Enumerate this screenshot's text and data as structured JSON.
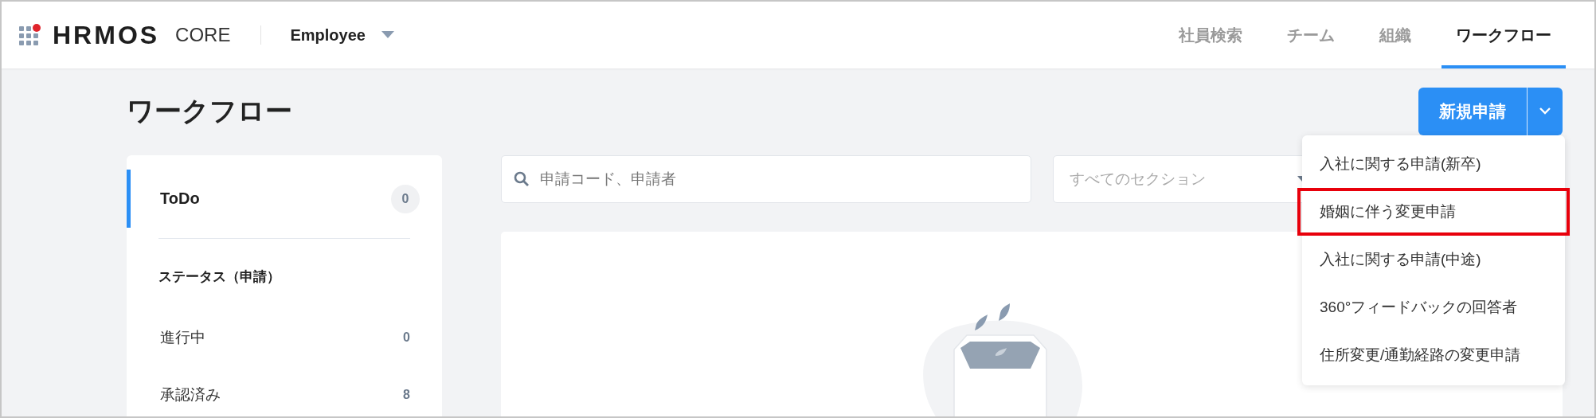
{
  "header": {
    "logo": {
      "wordmark": "HRMOS",
      "product": "CORE"
    },
    "role_switcher": {
      "label": "Employee"
    },
    "nav": [
      {
        "label": "社員検索",
        "selected": false
      },
      {
        "label": "チーム",
        "selected": false
      },
      {
        "label": "組織",
        "selected": false
      },
      {
        "label": "ワークフロー",
        "selected": true
      }
    ]
  },
  "page": {
    "title": "ワークフロー",
    "new_button": {
      "label": "新規申請"
    },
    "new_menu": {
      "items": [
        {
          "label": "入社に関する申請(新卒)",
          "highlighted": false
        },
        {
          "label": "婚姻に伴う変更申請",
          "highlighted": true
        },
        {
          "label": "入社に関する申請(中途)",
          "highlighted": false
        },
        {
          "label": "360°フィードバックの回答者",
          "highlighted": false
        },
        {
          "label": "住所変更/通勤経路の変更申請",
          "highlighted": false
        }
      ]
    }
  },
  "sidebar": {
    "todo": {
      "label": "ToDo",
      "count": "0",
      "selected": true
    },
    "status_heading": "ステータス（申請）",
    "status_items": [
      {
        "label": "進行中",
        "count": "0",
        "selected": false
      },
      {
        "label": "承認済み",
        "count": "8",
        "selected": false
      }
    ]
  },
  "filters": {
    "search": {
      "placeholder": "申請コード、申請者"
    },
    "section_select": {
      "placeholder": "すべてのセクション"
    }
  }
}
